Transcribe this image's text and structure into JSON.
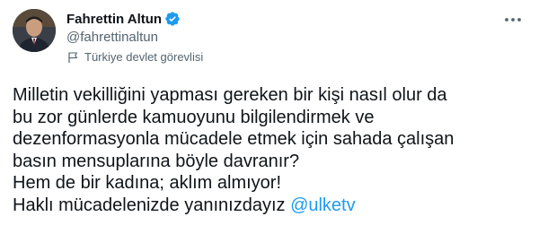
{
  "tweet": {
    "author": {
      "display_name": "Fahrettin Altun",
      "handle": "@fahrettinaltun",
      "label": "Türkiye devlet görevlisi",
      "verified_icon": "verified-badge-icon",
      "label_icon": "flag-icon",
      "avatar": "avatar"
    },
    "more_icon": "more-options-icon",
    "text_lines": [
      "Milletin vekilliğini yapması gereken bir kişi nasıl olur da",
      "bu zor günlerde kamuoyunu bilgilendirmek ve",
      "dezenformasyonla mücadele etmek için sahada çalışan",
      "basın mensuplarına böyle davranır?",
      "Hem de bir kadına; aklım almıyor!"
    ],
    "last_line_text": "Haklı mücadelenizde yanınızdayız ",
    "mention": "@ulketv"
  },
  "colors": {
    "text": "#0f1419",
    "secondary": "#536471",
    "accent": "#1d9bf0",
    "background": "#ffffff"
  }
}
